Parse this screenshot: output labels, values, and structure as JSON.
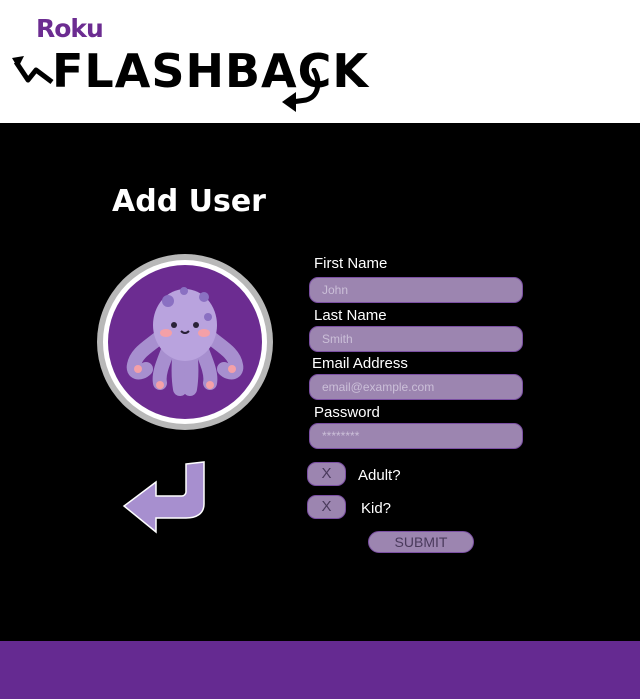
{
  "brand": {
    "roku": "Roku",
    "app_name": "FLASHBACK"
  },
  "page": {
    "title": "Add User"
  },
  "avatar": {
    "icon": "octopus"
  },
  "form": {
    "first_name": {
      "label": "First Name",
      "placeholder": "John"
    },
    "last_name": {
      "label": "Last Name",
      "placeholder": "Smith"
    },
    "email": {
      "label": "Email Address",
      "placeholder": "email@example.com"
    },
    "password": {
      "label": "Password",
      "placeholder": "********"
    },
    "adult": {
      "mark": "X",
      "label": "Adult?"
    },
    "kid": {
      "mark": "X",
      "label": "Kid?"
    },
    "submit_label": "SUBMIT"
  },
  "colors": {
    "brand_purple": "#6c2c91",
    "field": "#9c85b0",
    "footer": "#652a91"
  }
}
